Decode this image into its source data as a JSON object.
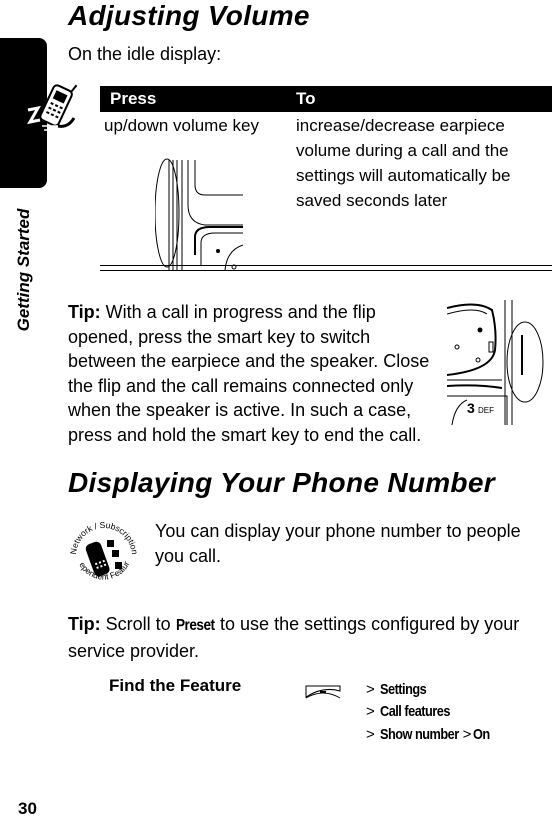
{
  "sidebar": {
    "section_label": "Getting Started",
    "icon": "phone-running-icon"
  },
  "section1": {
    "title": "Adjusting Volume",
    "intro": "On the idle display:",
    "table": {
      "headers": [
        "Press",
        "To"
      ],
      "rows": [
        {
          "press": "up/down volume key",
          "to_lines": [
            "increase/decrease earpiece",
            "volume during a call and the",
            "settings will automatically be",
            "saved seconds later"
          ]
        }
      ]
    },
    "tip_label": "Tip:",
    "tip_lines": [
      " With a call in progress and the flip",
      "opened, press the smart key to switch",
      "between the earpiece and the speaker. Close",
      "the flip and the call remains connected only",
      "when the speaker is active. In such a case,",
      "press and hold the smart key to end the call."
    ],
    "keypad_label": "3",
    "keypad_sub": "DEF"
  },
  "section2": {
    "title": "Displaying Your Phone Number",
    "badge_top": "Network / Subscription",
    "badge_bottom": "Dependent Feature",
    "intro_lines": [
      "You can display your phone number to people",
      "you call."
    ],
    "tip_label": "Tip:",
    "tip_pre": " Scroll to ",
    "tip_keyword": "Preset",
    "tip_post": " to use the settings configured by your",
    "tip_line2": "service provider.",
    "find_feature": {
      "label": "Find the Feature",
      "icon": "menu-key-icon",
      "path": [
        {
          "sep": ">",
          "item": "Settings"
        },
        {
          "sep": ">",
          "item": "Call features"
        },
        {
          "sep": ">",
          "item": "Show number",
          "sep2": ">",
          "item2": "On"
        }
      ]
    }
  },
  "page_number": "30"
}
